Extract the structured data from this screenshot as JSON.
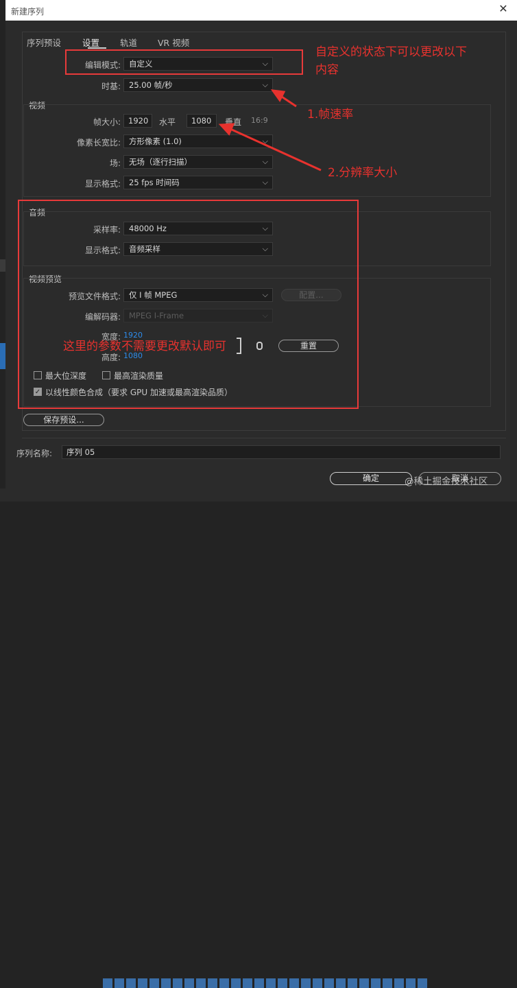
{
  "dialog": {
    "title": "新建序列",
    "close_glyph": "✕"
  },
  "tabs": [
    "序列预设",
    "设置",
    "轨道",
    "VR 视频"
  ],
  "settings": {
    "edit_mode_label": "编辑模式:",
    "edit_mode_value": "自定义",
    "timebase_label": "时基:",
    "timebase_value": "25.00  帧/秒"
  },
  "video": {
    "section": "视频",
    "frame_size_label": "帧大小:",
    "width": "1920",
    "horizontal_label": "水平",
    "height": "1080",
    "vertical_label": "垂直",
    "aspect": "16:9",
    "pixel_aspect_label": "像素长宽比:",
    "pixel_aspect_value": "方形像素 (1.0)",
    "field_label": "场:",
    "field_value": "无场（逐行扫描）",
    "display_label": "显示格式:",
    "display_value": "25 fps 时间码"
  },
  "audio": {
    "section": "音频",
    "sample_rate_label": "采样率:",
    "sample_rate_value": "48000 Hz",
    "display_label": "显示格式:",
    "display_value": "音频采样"
  },
  "preview": {
    "section": "视频预览",
    "file_format_label": "预览文件格式:",
    "file_format_value": "仅 I 帧 MPEG",
    "config_button": "配置...",
    "codec_label": "编解码器:",
    "codec_value": "MPEG I-Frame",
    "width_label": "宽度:",
    "width_value": "1920",
    "height_label": "高度:",
    "height_value": "1080",
    "reset_button": "重置",
    "max_bit_depth": "最大位深度",
    "max_render_quality": "最高渲染质量",
    "linear_color": "以线性颜色合成（要求 GPU 加速或最高渲染品质）"
  },
  "save_preset_button": "保存预设...",
  "sequence_name_label": "序列名称:",
  "sequence_name_value": "序列 05",
  "ok_button": "确定",
  "cancel_button": "取消",
  "annotations": {
    "custom_note_line1": "自定义的状态下可以更改以下",
    "custom_note_line2": "内容",
    "frame_rate_note": "1.帧速率",
    "resolution_note": "2.分辨率大小",
    "default_note": "这里的参数不需要更改默认即可",
    "color": "#e8322e"
  },
  "watermark": "@稀土掘金技术社区",
  "chevron_icon": "chevron-down-icon",
  "check_glyph": "✓"
}
